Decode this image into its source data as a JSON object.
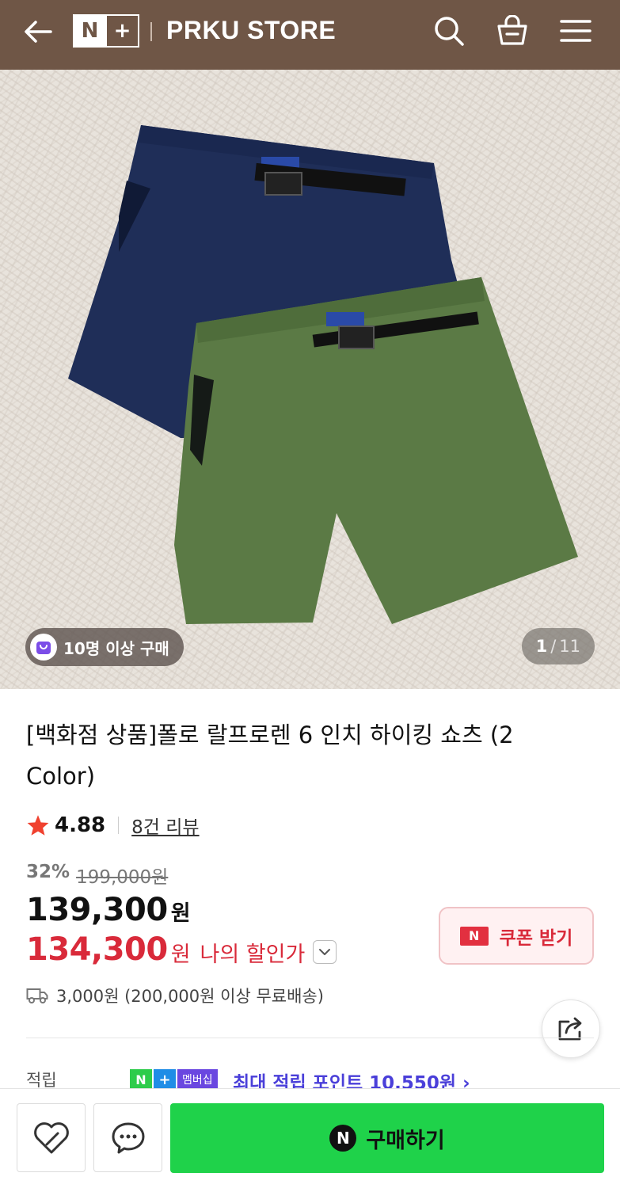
{
  "header": {
    "logo_text": "N+",
    "store_name": "PRKU STORE"
  },
  "gallery": {
    "badge_text": "10명 이상 구매",
    "current": "1",
    "separator": "/",
    "total": "11"
  },
  "product": {
    "title": "[백화점 상품]폴로 랄프로렌 6 인치 하이킹 쇼츠 (2 Color)",
    "rating": "4.88",
    "review_count": "8건 리뷰",
    "discount_percent": "32%",
    "original_price": "199,000원",
    "price": "139,300",
    "price_unit": "원",
    "my_price": "134,300",
    "my_price_unit": "원",
    "my_price_label": "나의 할인가",
    "shipping": "3,000원 (200,000원 이상 무료배송)"
  },
  "coupon": {
    "badge": "N",
    "label": "쿠폰 받기"
  },
  "points": {
    "label": "적립",
    "badge_n": "N",
    "badge_plus": "+",
    "badge_member": "멤버십",
    "text": "최대 적립 포인트 10,550원 ›"
  },
  "bottom_bar": {
    "buy_logo": "N",
    "buy_label": "구매하기"
  },
  "colors": {
    "header_bg": "#6f5646",
    "sale_red": "#d92a3a",
    "buy_green": "#1fd24a",
    "points_purple": "#4a3fd9"
  }
}
